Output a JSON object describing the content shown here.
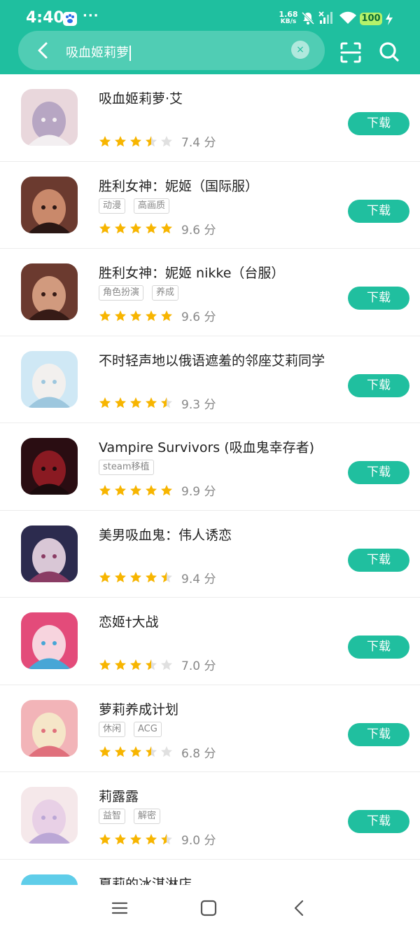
{
  "status_bar": {
    "time": "4:40",
    "network_speed_value": "1.68",
    "network_speed_unit": "KB/s",
    "battery": "100",
    "menu_dots": "···"
  },
  "search": {
    "query": "吸血姬莉萝",
    "clear_label": "×"
  },
  "colors": {
    "accent": "#1fbf9f",
    "star": "#f7b500",
    "star_empty": "#e0e0e0",
    "tag_text": "#888888"
  },
  "download_label": "下载",
  "results": [
    {
      "title": "吸血姬莉萝·艾",
      "tags": [],
      "stars": 3.5,
      "score": "7.4 分"
    },
    {
      "title": "胜利女神：妮姬（国际服）",
      "tags": [
        "动漫",
        "高画质"
      ],
      "stars": 5,
      "score": "9.6 分"
    },
    {
      "title": "胜利女神：妮姬 nikke（台服）",
      "tags": [
        "角色扮演",
        "养成"
      ],
      "stars": 5,
      "score": "9.6 分"
    },
    {
      "title": "不时轻声地以俄语遮羞的邻座艾莉同学",
      "tags": [],
      "stars": 4.5,
      "score": "9.3 分"
    },
    {
      "title": "Vampire Survivors (吸血鬼幸存者)",
      "tags": [
        "steam移植"
      ],
      "stars": 5,
      "score": "9.9 分"
    },
    {
      "title": "美男吸血鬼：伟人诱恋",
      "tags": [],
      "stars": 4.5,
      "score": "9.4 分"
    },
    {
      "title": "恋姬†大战",
      "tags": [],
      "stars": 3.5,
      "score": "7.0 分"
    },
    {
      "title": "萝莉养成计划",
      "tags": [
        "休闲",
        "ACG"
      ],
      "stars": 3.5,
      "score": "6.8 分"
    },
    {
      "title": "莉露露",
      "tags": [
        "益智",
        "解密"
      ],
      "stars": 4.5,
      "score": "9.0 分"
    },
    {
      "title": "夏莉的冰淇淋店",
      "tags": [],
      "stars": 0,
      "score": ""
    }
  ],
  "nav": {
    "menu_icon": "menu-icon",
    "home_icon": "home-icon",
    "back_icon": "back-icon"
  }
}
